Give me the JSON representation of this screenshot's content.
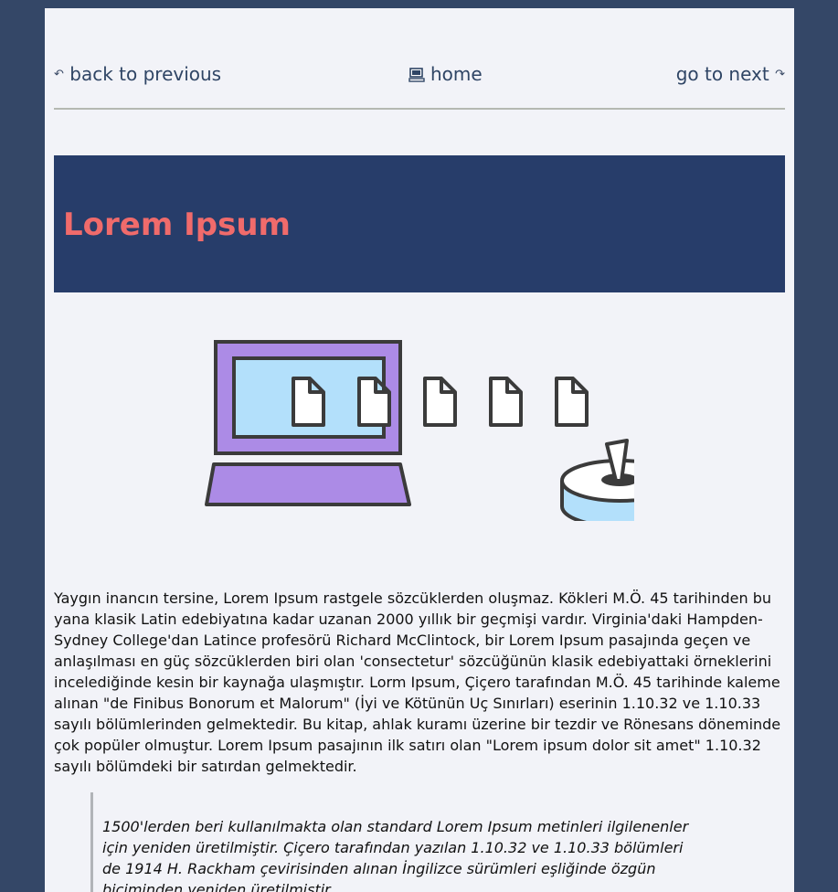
{
  "nav": {
    "prev_label": "back to previous",
    "prev_icon": "undo-arrow-icon",
    "home_label": "home",
    "home_icon": "computer-icon",
    "next_label": "go to next",
    "next_icon": "redo-arrow-icon"
  },
  "banner": {
    "title": "Lorem Ipsum",
    "background": "#273d6a",
    "title_color": "#f06b6b"
  },
  "illustration": {
    "icon": "laptop-files-to-disk-illustration",
    "colors": {
      "laptop": "#ac8be6",
      "screen": "#b3e0fb",
      "disk": "#b3e0fb",
      "stroke": "#3b3b3b"
    }
  },
  "article": {
    "paragraph": "Yaygın inancın tersine, Lorem Ipsum rastgele sözcüklerden oluşmaz. Kökleri M.Ö. 45 tarihinden bu yana klasik Latin edebiyatına kadar uzanan 2000 yıllık bir geçmişi vardır. Virginia'daki Hampden-Sydney College'dan Latince profesörü Richard McClintock, bir Lorem Ipsum pasajında geçen ve anlaşılması en güç sözcüklerden biri olan 'consectetur' sözcüğünün klasik edebiyattaki örneklerini incelediğinde kesin bir kaynağa ulaşmıştır. Lorm Ipsum, Çiçero tarafından M.Ö. 45 tarihinde kaleme alınan \"de Finibus Bonorum et Malorum\" (İyi ve Kötünün Uç Sınırları) eserinin 1.10.32 ve 1.10.33 sayılı bölümlerinden gelmektedir. Bu kitap, ahlak kuramı üzerine bir tezdir ve Rönesans döneminde çok popüler olmuştur. Lorem Ipsum pasajının ilk satırı olan \"Lorem ipsum dolor sit amet\" 1.10.32 sayılı bölümdeki bir satırdan gelmektedir.",
    "quote": "1500'lerden beri kullanılmakta olan standard Lorem Ipsum metinleri ilgilenenler için yeniden üretilmiştir. Çiçero tarafından yazılan 1.10.32 ve 1.10.33 bölümleri de 1914 H. Rackham çevirisinden alınan İngilizce sürümleri eşliğinde özgün biçiminden yeniden üretilmiştir."
  }
}
